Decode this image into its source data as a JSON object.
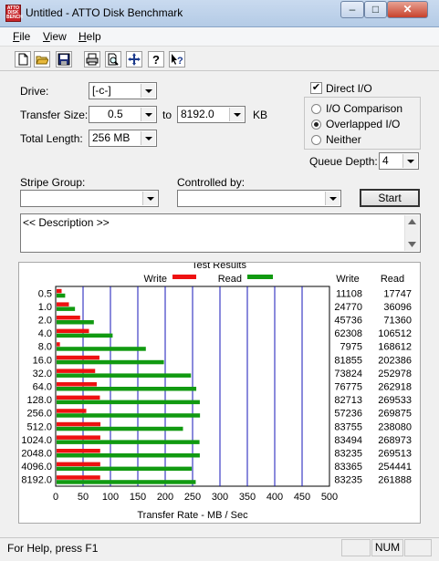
{
  "window": {
    "title": "Untitled - ATTO Disk Benchmark",
    "icon_text": "ATTO DISK BENCH",
    "controls": {
      "minimize": "–",
      "maximize": "□",
      "close": "✕"
    }
  },
  "menu": [
    {
      "label": "File",
      "underline": "F"
    },
    {
      "label": "View",
      "underline": "V"
    },
    {
      "label": "Help",
      "underline": "H"
    }
  ],
  "toolbar": [
    "new-icon",
    "open-icon",
    "save-icon",
    "print-icon",
    "print-preview-icon",
    "move-icon",
    "help-icon",
    "context-help-icon"
  ],
  "form": {
    "drive_label": "Drive:",
    "drive_value": "[-c-]",
    "transfer_size_label": "Transfer Size:",
    "transfer_from": "0.5",
    "to_label": "to",
    "transfer_to": "8192.0",
    "kb_label": "KB",
    "total_length_label": "Total Length:",
    "total_length_value": "256 MB",
    "direct_io_label": "Direct I/O",
    "io_options": [
      {
        "label": "I/O Comparison",
        "selected": false
      },
      {
        "label": "Overlapped I/O",
        "selected": true
      },
      {
        "label": "Neither",
        "selected": false
      }
    ],
    "queue_depth_label": "Queue Depth:",
    "queue_depth_value": "4",
    "stripe_group_label": "Stripe Group:",
    "controlled_by_label": "Controlled by:",
    "start_label": "Start",
    "description": "<< Description >>"
  },
  "chart_data": {
    "type": "bar",
    "orientation": "horizontal",
    "title": "Test Results",
    "xlabel": "Transfer Rate - MB / Sec",
    "xlim": [
      0,
      500
    ],
    "xticks": [
      "0",
      "50",
      "100",
      "150",
      "200",
      "250",
      "300",
      "350",
      "400",
      "450",
      "500"
    ],
    "categories": [
      "0.5",
      "1.0",
      "2.0",
      "4.0",
      "8.0",
      "16.0",
      "32.0",
      "64.0",
      "128.0",
      "256.0",
      "512.0",
      "1024.0",
      "2048.0",
      "4096.0",
      "8192.0"
    ],
    "series": [
      {
        "name": "Write",
        "color": "#ee1111",
        "values": [
          11108,
          24770,
          45736,
          62308,
          7975,
          81855,
          73824,
          76775,
          82713,
          57236,
          83755,
          83494,
          83235,
          83365,
          83235
        ]
      },
      {
        "name": "Read",
        "color": "#119a11",
        "values": [
          17747,
          36096,
          71360,
          106512,
          168612,
          202386,
          252978,
          262918,
          269533,
          269875,
          238080,
          268973,
          269513,
          254441,
          261888
        ]
      }
    ],
    "value_unit": "KB/s",
    "columns": [
      "Write",
      "Read"
    ]
  },
  "status": {
    "help": "For Help, press F1",
    "num": "NUM"
  }
}
